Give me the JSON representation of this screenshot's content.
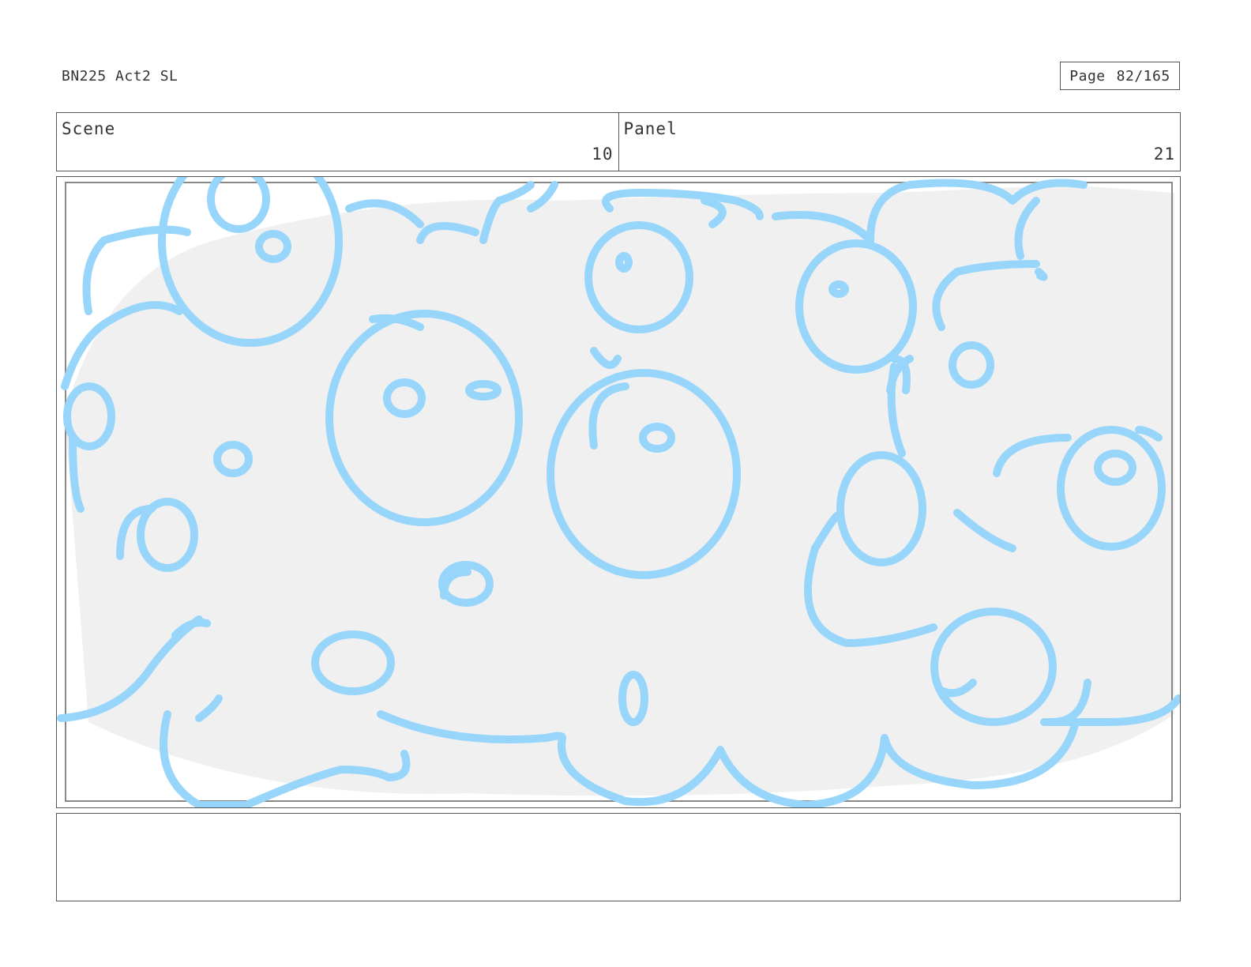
{
  "header": {
    "doc_title": "BN225 Act2 SL",
    "page_label": "Page",
    "page_number": "82/165"
  },
  "info": {
    "scene_label": "Scene",
    "scene_value": "10",
    "panel_label": "Panel",
    "panel_value": "21"
  },
  "artwork": {
    "background_color": "#f0f0f0",
    "stroke_color": "#97d6fa"
  },
  "notes": {
    "text": ""
  }
}
